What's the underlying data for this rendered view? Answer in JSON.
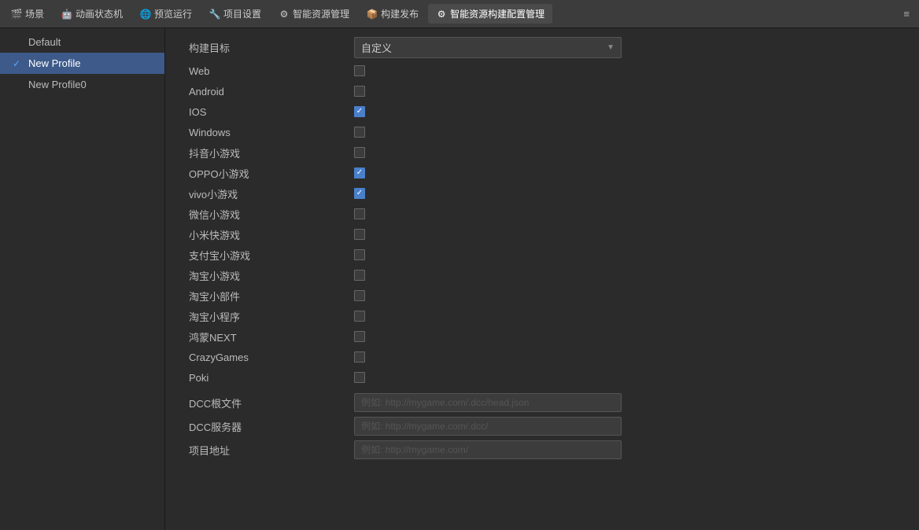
{
  "toolbar": {
    "items": [
      {
        "id": "scene",
        "icon": "🎬",
        "label": "场景"
      },
      {
        "id": "animation",
        "icon": "🤖",
        "label": "动画状态机"
      },
      {
        "id": "preview",
        "icon": "🌐",
        "label": "预览运行"
      },
      {
        "id": "project",
        "icon": "🔧",
        "label": "项目设置"
      },
      {
        "id": "smart-resource",
        "icon": "⚙",
        "label": "智能资源管理"
      },
      {
        "id": "build",
        "icon": "📦",
        "label": "构建发布"
      },
      {
        "id": "smart-build",
        "icon": "⚙",
        "label": "智能资源构建配置管理",
        "active": true
      }
    ],
    "menu_icon": "≡"
  },
  "sidebar": {
    "items": [
      {
        "id": "default",
        "label": "Default",
        "active": false,
        "checked": false
      },
      {
        "id": "new-profile",
        "label": "New Profile",
        "active": true,
        "checked": true
      },
      {
        "id": "new-profile0",
        "label": "New Profile0",
        "active": false,
        "checked": false
      }
    ]
  },
  "form": {
    "build_target_label": "构建目标",
    "build_target_value": "自定义",
    "platforms": [
      {
        "id": "web",
        "label": "Web",
        "checked": false
      },
      {
        "id": "android",
        "label": "Android",
        "checked": false
      },
      {
        "id": "ios",
        "label": "IOS",
        "checked": true
      },
      {
        "id": "windows",
        "label": "Windows",
        "checked": false
      },
      {
        "id": "douyin",
        "label": "抖音小游戏",
        "checked": false
      },
      {
        "id": "oppo",
        "label": "OPPO小游戏",
        "checked": true
      },
      {
        "id": "vivo",
        "label": "vivo小游戏",
        "checked": true
      },
      {
        "id": "wechat",
        "label": "微信小游戏",
        "checked": false
      },
      {
        "id": "xiaomi",
        "label": "小米快游戏",
        "checked": false
      },
      {
        "id": "alipay",
        "label": "支付宝小游戏",
        "checked": false
      },
      {
        "id": "taobao-game",
        "label": "淘宝小游戏",
        "checked": false
      },
      {
        "id": "taobao-widget",
        "label": "淘宝小部件",
        "checked": false
      },
      {
        "id": "taobao-mini",
        "label": "淘宝小程序",
        "checked": false
      },
      {
        "id": "hongnext",
        "label": "鸿蒙NEXT",
        "checked": false
      },
      {
        "id": "crazygames",
        "label": "CrazyGames",
        "checked": false
      },
      {
        "id": "poki",
        "label": "Poki",
        "checked": false
      }
    ],
    "dcc_root_label": "DCC根文件",
    "dcc_root_placeholder": "例如: http://mygame.com/.dcc/head.json",
    "dcc_server_label": "DCC服务器",
    "dcc_server_placeholder": "例如: http://mygame.com/.dcc/",
    "project_url_label": "项目地址",
    "project_url_placeholder": "例如: http://mygame.com/"
  }
}
